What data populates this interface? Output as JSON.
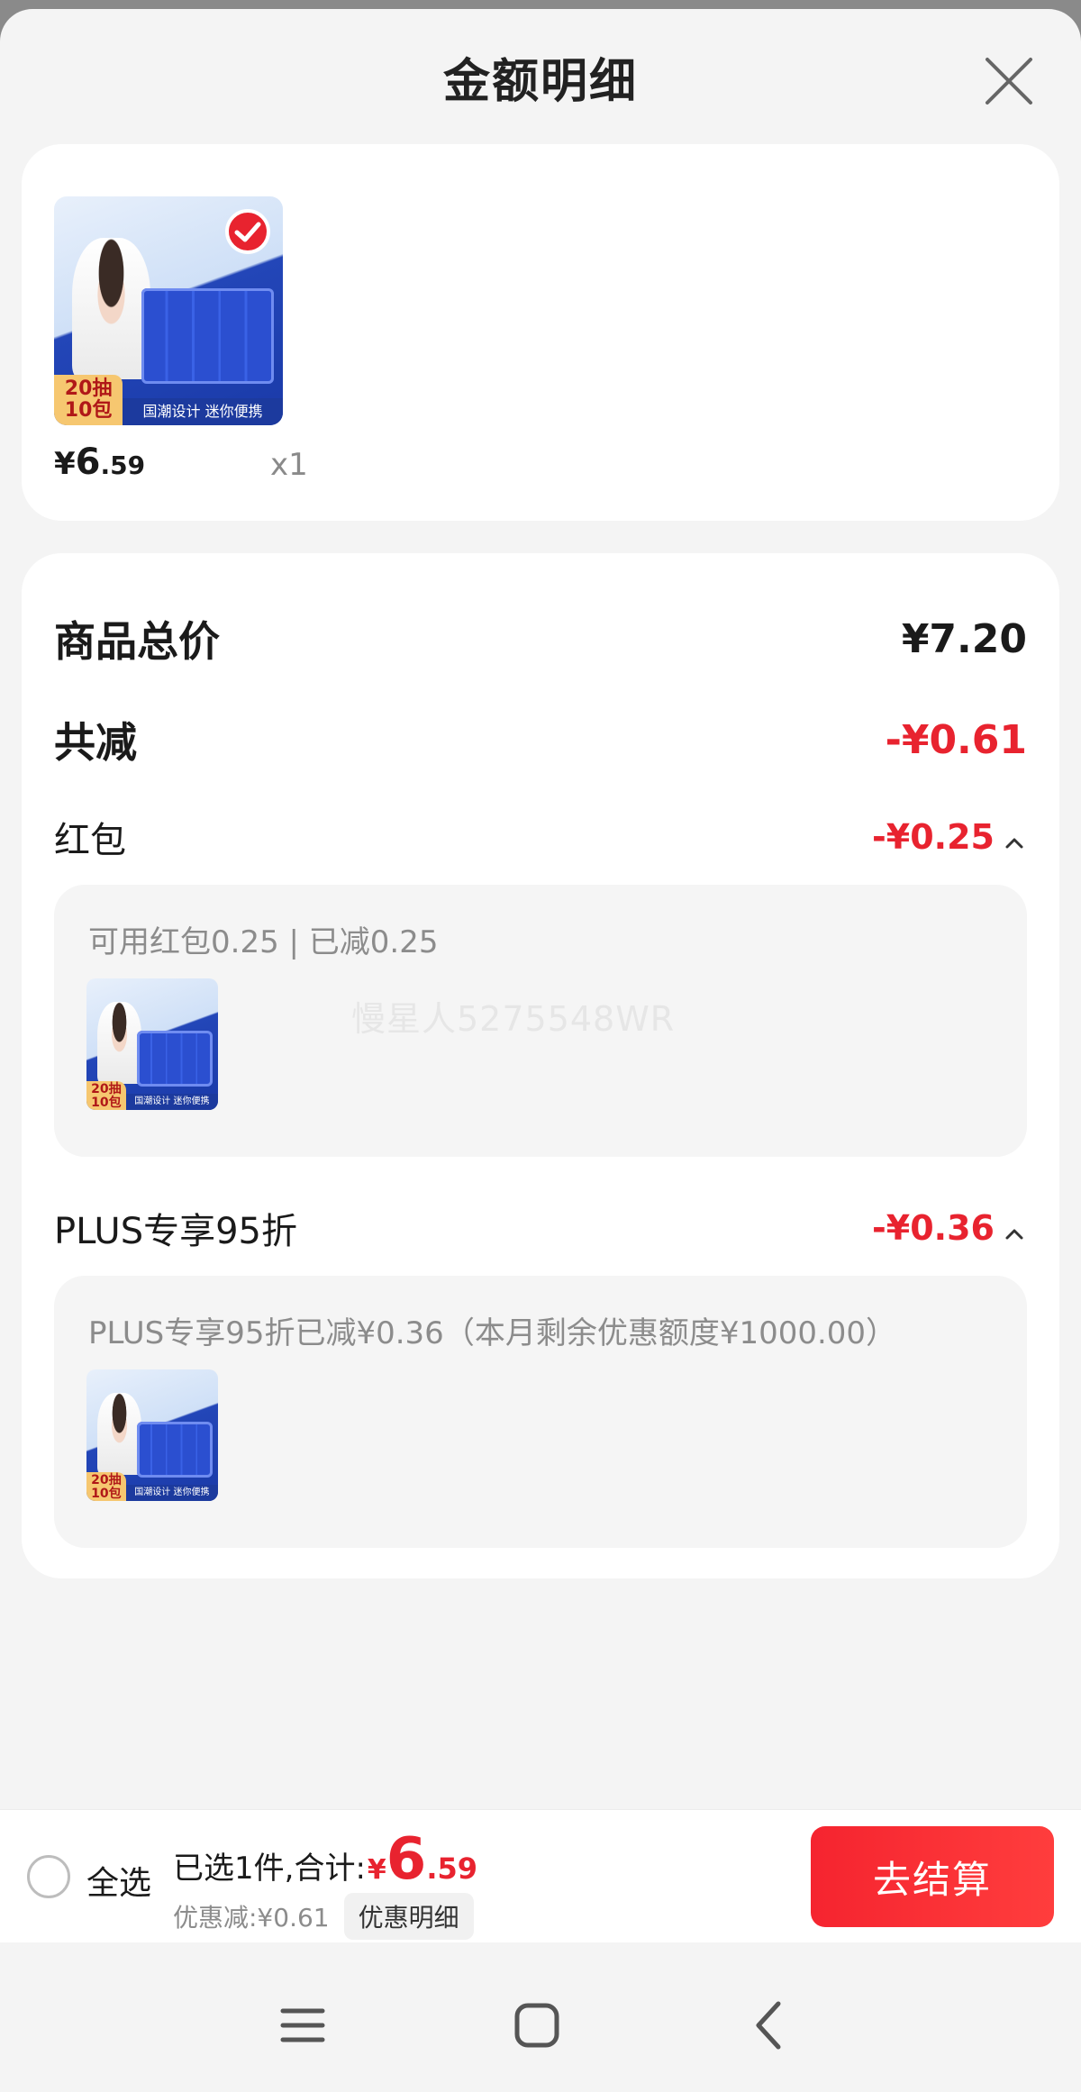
{
  "header": {
    "title": "金额明细"
  },
  "product": {
    "thumb_badge": "20抽\n10包",
    "thumb_band": "国潮设计 迷你便携",
    "price_yen": "¥",
    "price_int": "6",
    "price_dec": ".59",
    "quantity": "x1",
    "selected": true
  },
  "summary": {
    "total_label": "商品总价",
    "total_value": "¥7.20",
    "reduced_label": "共减",
    "reduced_value": "-¥0.61",
    "redpacket": {
      "label": "红包",
      "value": "-¥0.25",
      "detail": "可用红包0.25 | 已减0.25"
    },
    "plus": {
      "label": "PLUS专享95折",
      "value": "-¥0.36",
      "detail": "PLUS专享95折已减¥0.36（本月剩余优惠额度¥1000.00）"
    },
    "watermark": "慢星人5275548WR"
  },
  "checkout_bar": {
    "select_all": "全选",
    "selected_text": "已选1件,合计:",
    "total_yen": "¥",
    "total_int": "6",
    "total_dec": ".59",
    "discount_text": "优惠减:¥0.61",
    "discount_detail": "优惠明细",
    "checkout": "去结算"
  },
  "colors": {
    "accent_red": "#e8232f",
    "sheet_bg": "#f4f4f4",
    "card_bg": "#ffffff"
  },
  "icons": {
    "close": "close-icon",
    "chevron": "chevron-up-icon",
    "nav_menu": "menu-icon",
    "nav_home": "home-icon",
    "nav_back": "back-icon"
  }
}
